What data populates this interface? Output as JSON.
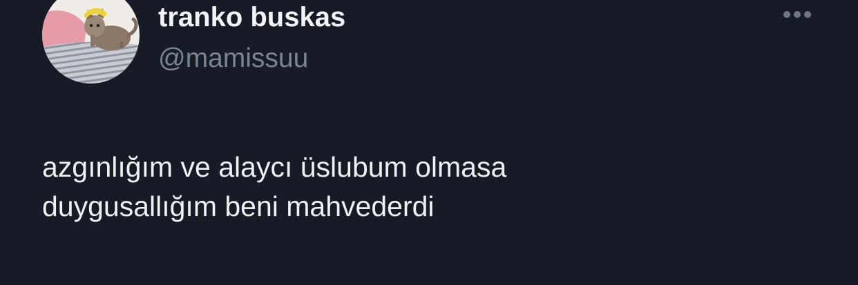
{
  "author": {
    "display_name": "tranko buskas",
    "handle": "@mamissuu",
    "avatar_icon": "kitten-avatar"
  },
  "tweet": {
    "lines": [
      "azgınlığım ve alaycı üslubum olmasa",
      "duygusallığım beni mahvederdi"
    ]
  },
  "actions": {
    "more_icon": "more-horizontal-icon"
  },
  "colors": {
    "background": "#161b26",
    "text": "#eef0f1",
    "muted": "#7b8591"
  }
}
